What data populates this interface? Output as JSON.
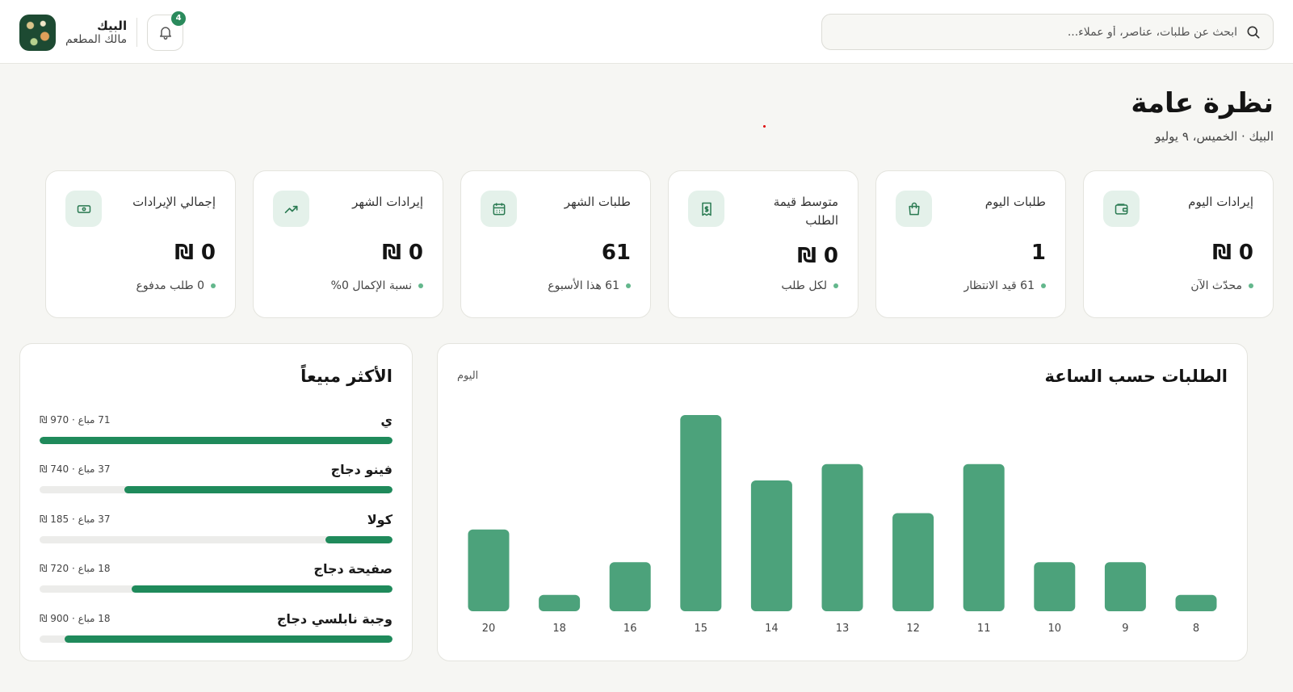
{
  "header": {
    "search_placeholder": "ابحث عن طلبات، عناصر، أو عملاء...",
    "notifications_count": "4",
    "user_name": "البيك",
    "user_role": "مالك المطعم"
  },
  "page": {
    "title": "نظرة عامة",
    "subtitle": "البيك · الخميس، ٩ يوليو"
  },
  "stats": [
    {
      "label": "إيرادات اليوم",
      "value": "0 ₪",
      "sub": "محدّث الآن",
      "icon": "wallet-icon"
    },
    {
      "label": "طلبات اليوم",
      "value": "1",
      "sub": "61 قيد الانتظار",
      "icon": "shopping-bag-icon"
    },
    {
      "label": "متوسط قيمة الطلب",
      "value": "0 ₪",
      "sub": "لكل طلب",
      "icon": "receipt-icon"
    },
    {
      "label": "طلبات الشهر",
      "value": "61",
      "sub": "61 هذا الأسبوع",
      "icon": "calendar-icon"
    },
    {
      "label": "إيرادات الشهر",
      "value": "0 ₪",
      "sub": "نسبة الإكمال 0%",
      "icon": "trending-up-icon"
    },
    {
      "label": "إجمالي الإيرادات",
      "value": "0 ₪",
      "sub": "0 طلب مدفوع",
      "icon": "banknote-icon"
    }
  ],
  "orders_chart": {
    "title": "الطلبات حسب الساعة",
    "period": "اليوم"
  },
  "chart_data": {
    "type": "bar",
    "title": "الطلبات حسب الساعة",
    "categories": [
      "8",
      "9",
      "10",
      "11",
      "12",
      "13",
      "14",
      "15",
      "16",
      "18",
      "20"
    ],
    "values": [
      1,
      3,
      3,
      9,
      6,
      9,
      8,
      12,
      3,
      1,
      5
    ],
    "ylim": [
      0,
      12
    ],
    "grid": false,
    "color": "#4ca27b"
  },
  "best_sellers": {
    "title": "الأكثر مبيعاً",
    "items": [
      {
        "name": "ي",
        "meta": "71 مباع · 970 ₪",
        "fraction": 1.0
      },
      {
        "name": "فينو دجاج",
        "meta": "37 مباع · 740 ₪",
        "fraction": 0.76
      },
      {
        "name": "كولا",
        "meta": "37 مباع · 185 ₪",
        "fraction": 0.19
      },
      {
        "name": "صفيحة دجاج",
        "meta": "18 مباع · 720 ₪",
        "fraction": 0.74
      },
      {
        "name": "وجبة نابلسي دجاج",
        "meta": "18 مباع · 900 ₪",
        "fraction": 0.93
      }
    ]
  },
  "colors": {
    "accent": "#1f8a5b",
    "bar": "#4ca27b",
    "icon_bg": "#e4f1ea",
    "background": "#f6f6f3"
  }
}
